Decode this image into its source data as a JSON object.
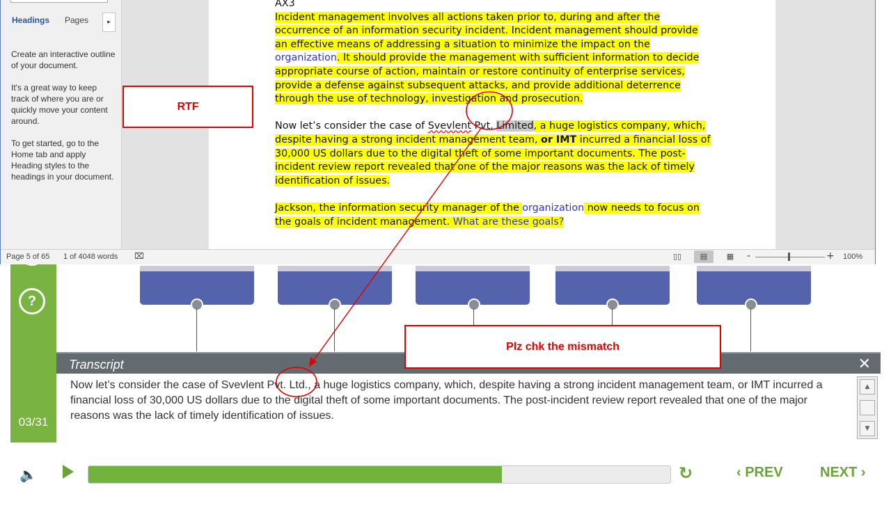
{
  "word": {
    "nav_tabs": {
      "headings": "Headings",
      "pages": "Pages",
      "more_arrow": "▸"
    },
    "nav_help": [
      "Create an interactive outline of your document.",
      "It's a great way to keep track of where you are or quickly move your content around.",
      "To get started, go to the Home tab and apply Heading styles to the headings in your document."
    ],
    "doc": {
      "heading": "AX3",
      "p1_a": "Incident management involves all actions taken prior to, during and after the occurrence of an information security incident. Incident management should provide an effective means of addressing a situation to minimize the impact on the ",
      "p1_link": "organization",
      "p1_b": ". It should provide the management with sufficient information to decide appropriate course of action, maintain or restore continuity of enterprise services, provide a defense against subsequent attacks, and provide additional deterrence through the use of technology, investigation and prosecution.",
      "p2_a": "Now let’s consider the case of ",
      "p2_name": "Svevlent",
      "p2_b": " Pvt. ",
      "p2_sel": "Limited",
      "p2_c": ", a huge logistics company, which, despite having a strong incident management team, ",
      "p2_bold": "or IMT",
      "p2_d": " incurred a financial loss of 30,000 US dollars due to the digital theft of some important documents. The post-incident review report revealed that one of the major reasons was the lack of timely identification of issues.",
      "p3_a": "Jackson, the information security manager of the ",
      "p3_link": "organization",
      "p3_b": " now needs to focus on the goals of incident management. ",
      "p3_q": "What are these goals?"
    },
    "status": {
      "page": "Page 5 of 65",
      "words": "1 of 4048 words",
      "zoom_minus": "-",
      "zoom_plus": "+",
      "zoom": "100%"
    }
  },
  "player": {
    "help_icon": "?",
    "slide_counter": "03/31",
    "transcript_title": "Transcript",
    "transcript_close": "✕",
    "transcript_text": "Now let’s consider the case of Svevlent Pvt. Ltd., a huge logistics company, which, despite having a strong incident management team, or IMT incurred a financial loss of 30,000 US dollars due to the digital theft of some important documents. The post-incident review report revealed that one of the major reasons was the lack of timely identification of issues.",
    "scroll_up": "▲",
    "scroll_down": "▼",
    "progress": 0.71,
    "prev_label": "‹ PREV",
    "next_label": "NEXT ›",
    "colors": {
      "green": "#71b33c",
      "timeline_blue": "#5563ad"
    }
  },
  "annotations": {
    "rtf_label": "RTF",
    "mismatch_label": "Plz chk the mismatch",
    "color": "#e00000"
  }
}
